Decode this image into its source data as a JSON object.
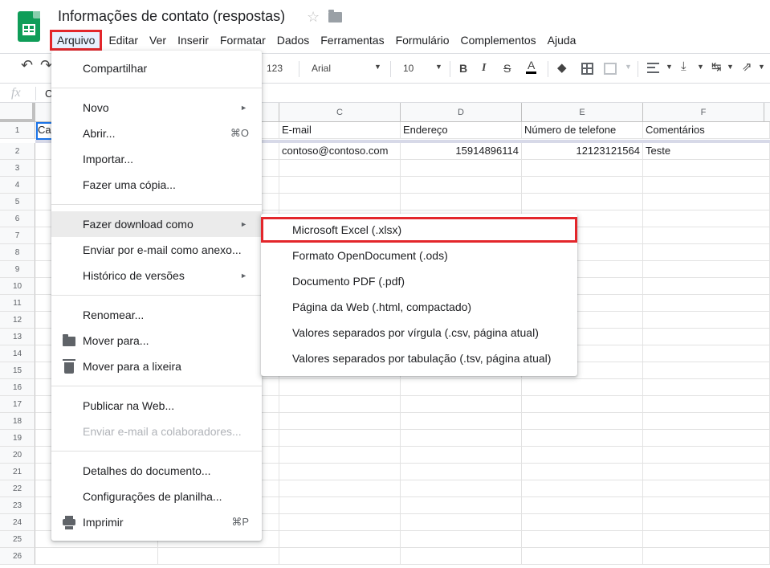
{
  "header": {
    "doc_title": "Informações de contato (respostas)",
    "star_icon": "☆"
  },
  "menubar": {
    "items": [
      "Arquivo",
      "Editar",
      "Ver",
      "Inserir",
      "Formatar",
      "Dados",
      "Ferramentas",
      "Formulário",
      "Complementos",
      "Ajuda"
    ],
    "active": "Arquivo"
  },
  "toolbar": {
    "undo": "↶",
    "redo": "↷",
    "number_format": "123",
    "font": "Arial",
    "font_size": "10",
    "bold": "B",
    "italic": "I",
    "strike": "S",
    "text_color": "A",
    "fill": "◆",
    "valign": "⤓",
    "wrap": "↹",
    "rotate": "⇗",
    "caret": "▼"
  },
  "formula_bar": {
    "fx": "fx",
    "value": "C"
  },
  "sheet": {
    "columns": [
      "C",
      "D",
      "E",
      "F"
    ],
    "rows": [
      "1",
      "2",
      "3",
      "4",
      "5",
      "6",
      "7",
      "8",
      "9",
      "10",
      "11",
      "12",
      "13",
      "14",
      "15",
      "16",
      "17",
      "18",
      "19",
      "20",
      "21",
      "22",
      "23",
      "24",
      "25",
      "26"
    ],
    "a1_partial": "Ca",
    "header_row": [
      "E-mail",
      "Endereço",
      "Número de telefone",
      "Comentários"
    ],
    "row2": [
      "contoso@contoso.com",
      "15914896114",
      "12123121564",
      "Teste"
    ]
  },
  "file_menu": {
    "share": "Compartilhar",
    "new": "Novo",
    "open": "Abrir...",
    "open_shortcut": "⌘O",
    "import": "Importar...",
    "copy": "Fazer uma cópia...",
    "download": "Fazer download como",
    "email_attach": "Enviar por e-mail como anexo...",
    "version_history": "Histórico de versões",
    "rename": "Renomear...",
    "move": "Mover para...",
    "trash": "Mover para a lixeira",
    "publish": "Publicar na Web...",
    "email_collab": "Enviar e-mail a colaboradores...",
    "doc_details": "Detalhes do documento...",
    "settings": "Configurações de planilha...",
    "print": "Imprimir",
    "print_shortcut": "⌘P",
    "arrow": "►"
  },
  "download_submenu": {
    "items": [
      "Microsoft Excel (.xlsx)",
      "Formato OpenDocument (.ods)",
      "Documento PDF (.pdf)",
      "Página da Web (.html, compactado)",
      "Valores separados por vírgula (.csv, página atual)",
      "Valores separados por tabulação (.tsv, página atual)"
    ],
    "selected": "Microsoft Excel (.xlsx)"
  },
  "colors": {
    "highlight_box": "#e3262b",
    "sheets_green": "#0f9d58",
    "selection_blue": "#1a73e8"
  }
}
